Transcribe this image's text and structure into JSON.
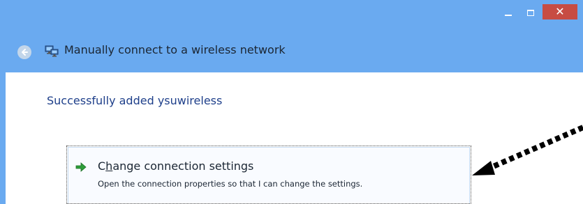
{
  "window": {
    "minimize_label": "–",
    "maximize_label": "□",
    "close_label": "✕",
    "accent_color": "#6aaaf0",
    "close_color": "#c74c43"
  },
  "nav": {
    "back_icon": "back-arrow-icon",
    "network_icon": "network-icon",
    "title": "Manually connect to a wireless network"
  },
  "content": {
    "heading": "Successfully added ysuwireless",
    "command": {
      "icon": "green-arrow-icon",
      "title_before": "C",
      "title_underlined": "h",
      "title_after": "ange connection settings",
      "description": "Open the connection properties so that I can change the settings."
    }
  },
  "annotation": {
    "icon": "dotted-pointer-arrow"
  }
}
